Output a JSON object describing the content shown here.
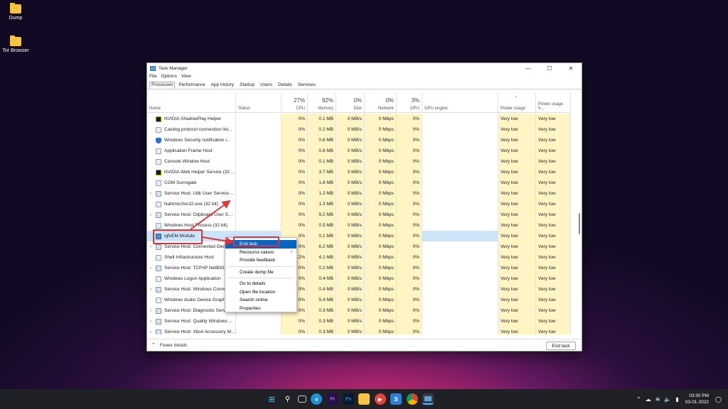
{
  "desktop": {
    "icons": [
      {
        "label": "Dump"
      },
      {
        "label": "Tor Browser"
      }
    ]
  },
  "window": {
    "title": "Task Manager",
    "menu": [
      "File",
      "Options",
      "View"
    ],
    "tabs": [
      "Processes",
      "Performance",
      "App history",
      "Startup",
      "Users",
      "Details",
      "Services"
    ],
    "active_tab": "Processes"
  },
  "columns": {
    "name": "Name",
    "status": "Status",
    "cpu": {
      "pct": "27%",
      "label": "CPU"
    },
    "memory": {
      "pct": "92%",
      "label": "Memory"
    },
    "disk": {
      "pct": "0%",
      "label": "Disk"
    },
    "network": {
      "pct": "0%",
      "label": "Network"
    },
    "gpu": {
      "pct": "3%",
      "label": "GPU"
    },
    "gpu_engine": "GPU engine",
    "power": "Power usage",
    "power_trend": "Power usage tr..."
  },
  "processes": [
    {
      "name": "NVIDIA ShadowPlay Helper",
      "icon": "nvidia-icon",
      "expand": false,
      "cpu": "0%",
      "mem": "0.1 MB",
      "disk": "0 MB/s",
      "net": "0 Mbps",
      "gpu": "0%",
      "power": "Very low",
      "power_trend": "Very low"
    },
    {
      "name": "Casting protocol connection list...",
      "icon": "app-window-icon",
      "expand": false,
      "cpu": "0%",
      "mem": "0.2 MB",
      "disk": "0 MB/s",
      "net": "0 Mbps",
      "gpu": "0%",
      "power": "Very low",
      "power_trend": "Very low"
    },
    {
      "name": "Windows Security notification i...",
      "icon": "shield-icon",
      "expand": false,
      "cpu": "0%",
      "mem": "0.6 MB",
      "disk": "0 MB/s",
      "net": "0 Mbps",
      "gpu": "0%",
      "power": "Very low",
      "power_trend": "Very low"
    },
    {
      "name": "Application Frame Host",
      "icon": "app-window-icon",
      "expand": false,
      "cpu": "0%",
      "mem": "0.8 MB",
      "disk": "0 MB/s",
      "net": "0 Mbps",
      "gpu": "0%",
      "power": "Very low",
      "power_trend": "Very low"
    },
    {
      "name": "Console Window Host",
      "icon": "app-window-icon",
      "expand": false,
      "cpu": "0%",
      "mem": "0.1 MB",
      "disk": "0 MB/s",
      "net": "0 Mbps",
      "gpu": "0%",
      "power": "Very low",
      "power_trend": "Very low"
    },
    {
      "name": "NVIDIA Web Helper Service (32 ...",
      "icon": "nvidia-icon",
      "expand": false,
      "cpu": "0%",
      "mem": "3.7 MB",
      "disk": "0 MB/s",
      "net": "0 Mbps",
      "gpu": "0%",
      "power": "Very low",
      "power_trend": "Very low"
    },
    {
      "name": "COM Surrogate",
      "icon": "app-window-icon",
      "expand": false,
      "cpu": "0%",
      "mem": "1.8 MB",
      "disk": "0 MB/s",
      "net": "0 Mbps",
      "gpu": "0%",
      "power": "Very low",
      "power_trend": "Very low"
    },
    {
      "name": "Service Host: Udk User Service_3...",
      "icon": "gear-icon",
      "expand": true,
      "cpu": "0%",
      "mem": "1.2 MB",
      "disk": "0 MB/s",
      "net": "0 Mbps",
      "gpu": "0%",
      "power": "Very low",
      "power_trend": "Very low"
    },
    {
      "name": "NahimicSvc32.exe (32 bit)",
      "icon": "app-window-icon",
      "expand": false,
      "cpu": "0%",
      "mem": "1.3 MB",
      "disk": "0 MB/s",
      "net": "0 Mbps",
      "gpu": "0%",
      "power": "Very low",
      "power_trend": "Very low"
    },
    {
      "name": "Service Host: Clipboard User Ser...",
      "icon": "gear-icon",
      "expand": true,
      "cpu": "0%",
      "mem": "9.2 MB",
      "disk": "0 MB/s",
      "net": "0 Mbps",
      "gpu": "0%",
      "power": "Very low",
      "power_trend": "Very low"
    },
    {
      "name": "Windows Host Process (32 bit)",
      "icon": "app-window-icon",
      "expand": false,
      "cpu": "0%",
      "mem": "0.5 MB",
      "disk": "0 MB/s",
      "net": "0 Mbps",
      "gpu": "0%",
      "power": "Very low",
      "power_trend": "Very low"
    },
    {
      "name": "igfxEM Module",
      "icon": "igfx-icon",
      "expand": false,
      "selected": true,
      "cpu": "0%",
      "mem": "0.1 MB",
      "disk": "0 MB/s",
      "net": "0 Mbps",
      "gpu": "0%",
      "power": "Very low",
      "power_trend": "Very low"
    },
    {
      "name": "Service Host: Connected Devi...",
      "icon": "gear-icon",
      "expand": true,
      "cpu": "0%",
      "mem": "6.2 MB",
      "disk": "0 MB/s",
      "net": "0 Mbps",
      "gpu": "0%",
      "power": "Very low",
      "power_trend": "Very low"
    },
    {
      "name": "Shell Infrastructure Host",
      "icon": "app-window-icon",
      "expand": false,
      "cpu": "0.2%",
      "mem": "4.1 MB",
      "disk": "0 MB/s",
      "net": "0 Mbps",
      "gpu": "0%",
      "power": "Very low",
      "power_trend": "Very low"
    },
    {
      "name": "Service Host: TCP/IP NetBIOS ...",
      "icon": "gear-icon",
      "expand": true,
      "cpu": "0%",
      "mem": "0.2 MB",
      "disk": "0 MB/s",
      "net": "0 Mbps",
      "gpu": "0%",
      "power": "Very low",
      "power_trend": "Very low"
    },
    {
      "name": "Windows Logon Application",
      "icon": "app-window-icon",
      "expand": false,
      "cpu": "0%",
      "mem": "0.4 MB",
      "disk": "0 MB/s",
      "net": "0 Mbps",
      "gpu": "0%",
      "power": "Very low",
      "power_trend": "Very low"
    },
    {
      "name": "Service Host: Windows Conne...",
      "icon": "gear-icon",
      "expand": true,
      "cpu": "0%",
      "mem": "0.4 MB",
      "disk": "0 MB/s",
      "net": "0 Mbps",
      "gpu": "0%",
      "power": "Very low",
      "power_trend": "Very low"
    },
    {
      "name": "Windows Audio Device Graph ...",
      "icon": "app-window-icon",
      "expand": false,
      "cpu": "0%",
      "mem": "5.4 MB",
      "disk": "0 MB/s",
      "net": "0 Mbps",
      "gpu": "0%",
      "power": "Very low",
      "power_trend": "Very low"
    },
    {
      "name": "Service Host: Diagnostic Servic...",
      "icon": "gear-icon",
      "expand": true,
      "cpu": "0%",
      "mem": "0.3 MB",
      "disk": "0 MB/s",
      "net": "0 Mbps",
      "gpu": "0%",
      "power": "Very low",
      "power_trend": "Very low"
    },
    {
      "name": "Service Host: Quality Windows ...",
      "icon": "gear-icon",
      "expand": true,
      "cpu": "0%",
      "mem": "0.3 MB",
      "disk": "0 MB/s",
      "net": "0 Mbps",
      "gpu": "0%",
      "power": "Very low",
      "power_trend": "Very low"
    },
    {
      "name": "Service Host: Xbox Accessory M...",
      "icon": "gear-icon",
      "expand": true,
      "cpu": "0%",
      "mem": "0.3 MB",
      "disk": "0 MB/s",
      "net": "0 Mbps",
      "gpu": "0%",
      "power": "Very low",
      "power_trend": "Very low"
    }
  ],
  "context_menu": {
    "items": [
      "End task",
      "Resource values",
      "Provide feedback",
      "Create dump file",
      "Go to details",
      "Open file location",
      "Search online",
      "Properties"
    ]
  },
  "footer": {
    "fewer_details": "Fewer details",
    "end_task": "End task"
  },
  "taskbar": {
    "icons": [
      "windows-start-icon",
      "search-icon",
      "task-view-icon",
      "edge-icon",
      "premiere-icon",
      "photoshop-icon",
      "file-explorer-icon",
      "media-player-icon",
      "s-app-icon",
      "chrome-icon",
      "task-manager-icon"
    ],
    "time": "03:30 PM",
    "date": "03-01-2022"
  },
  "colors": {
    "accent": "#0a64c2",
    "annotation": "#e0323a",
    "heat": "#fff4c4"
  }
}
